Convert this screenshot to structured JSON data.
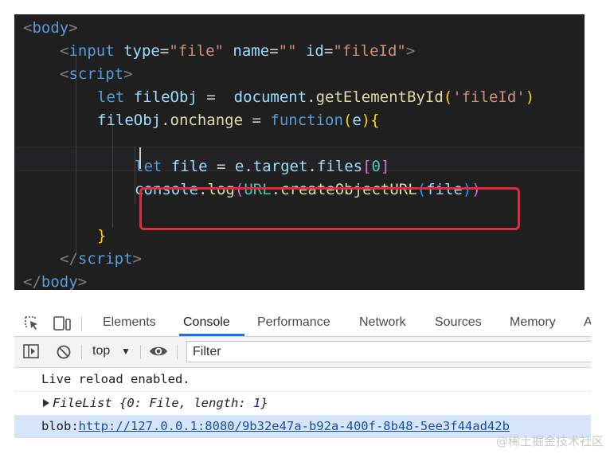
{
  "code": {
    "line1": {
      "open": "<",
      "tag": "body",
      "close": ">"
    },
    "line2": {
      "open": "<",
      "tag": "input",
      "a1": "type",
      "eq1": "=",
      "v1": "\"file\"",
      "a2": "name",
      "eq2": "=",
      "v2": "\"\"",
      "a3": "id",
      "eq3": "=",
      "v3": "\"fileId\"",
      "close": ">"
    },
    "line3": {
      "open": "<",
      "tag": "script",
      "close": ">"
    },
    "line4": {
      "kw": "let",
      "var": "fileObj",
      "eq": " = ",
      "obj": "document",
      "dot": ".",
      "fn": "getElementById",
      "p1": "(",
      "str": "'fileId'",
      "p2": ")"
    },
    "line5": {
      "var": "fileObj",
      "dot": ".",
      "prop": "onchange",
      "eq": " = ",
      "kw": "function",
      "p1": "(",
      "arg": "e",
      "p2": ")",
      "brace": "{"
    },
    "line7": {
      "kw": "let",
      "var": "file",
      "eq": " = ",
      "obj": "e",
      "dot1": ".",
      "prop1": "target",
      "dot2": ".",
      "prop2": "files",
      "b1": "[",
      "num": "0",
      "b2": "]"
    },
    "line8": {
      "obj": "console",
      "dot1": ".",
      "fn": "log",
      "p1": "(",
      "cls": "URL",
      "dot2": ".",
      "fn2": "createObjectURL",
      "p2": "(",
      "arg": "file",
      "p3": ")",
      "p4": ")"
    },
    "line10": {
      "brace": "}"
    },
    "line11": {
      "open": "</",
      "tag": "script",
      "close": ">"
    },
    "line12": {
      "open": "</",
      "tag": "body",
      "close": ">"
    }
  },
  "devtools": {
    "tabs": [
      "Elements",
      "Console",
      "Performance",
      "Network",
      "Sources",
      "Memory",
      "A"
    ],
    "active_tab": "Console",
    "context": "top",
    "context_arrow": "▼",
    "filter_placeholder": "Filter",
    "console": {
      "line1": "Live reload enabled.",
      "line2": {
        "name": "FileList",
        "open": " {",
        "key0": "0",
        "colon0": ": ",
        "val0": "File",
        "sep": ", ",
        "key1": "length",
        "colon1": ": ",
        "val1": "1",
        "close": "}"
      },
      "line3": {
        "prefix": "blob:",
        "url": "http://127.0.0.1:8080/9b32e47a-b92a-400f-8b48-5ee3f44ad42b"
      }
    }
  },
  "watermark": "@稀土掘金技术社区",
  "colors": {
    "highlight_box": "#e02b3e",
    "active_tab_underline": "#1a73e8",
    "editor_bg": "#1f1f20"
  }
}
